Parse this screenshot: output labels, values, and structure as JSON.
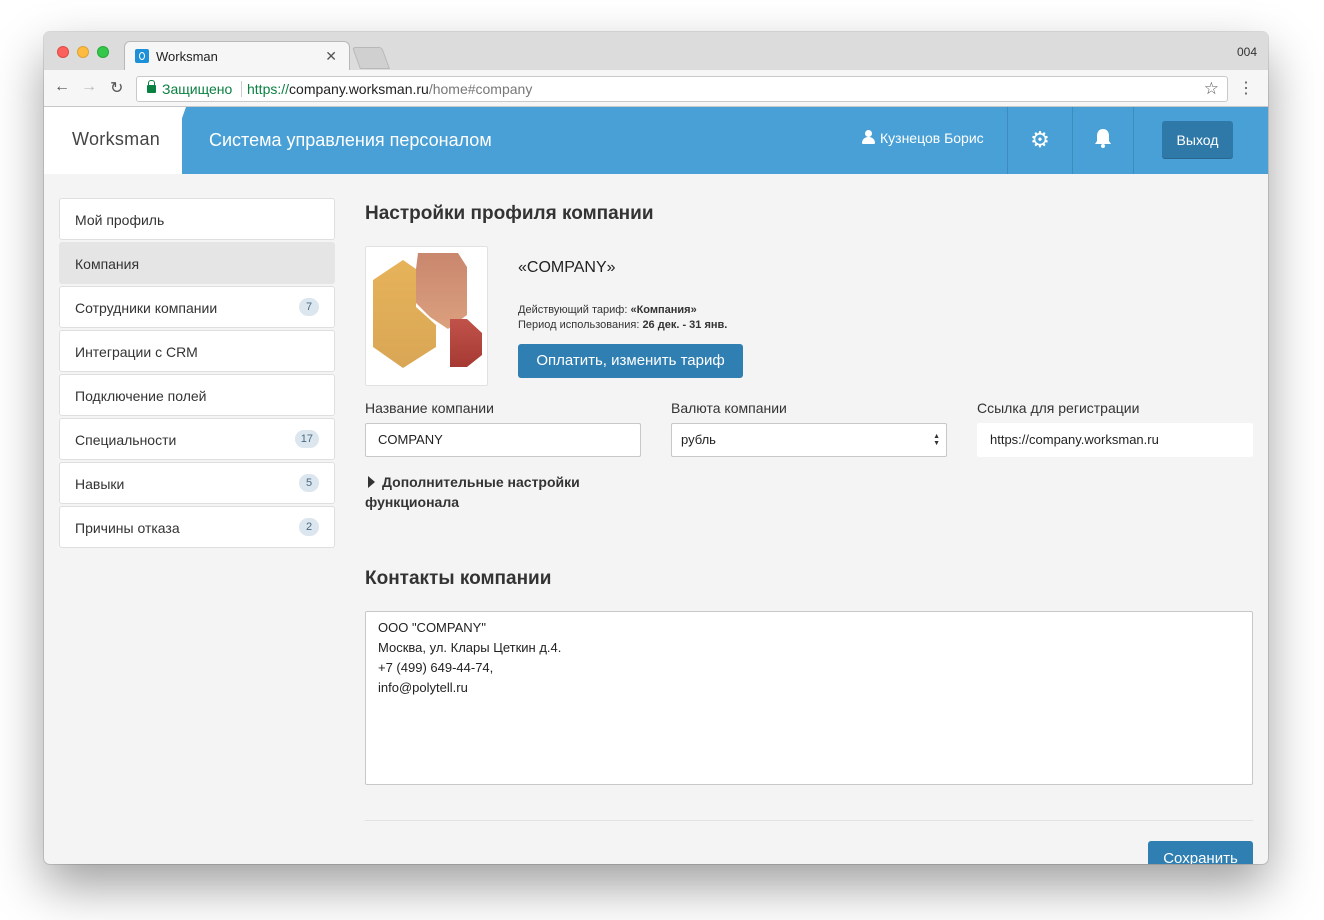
{
  "browser": {
    "tab_title": "Worksman",
    "window_label": "004",
    "secure_label": "Защищено",
    "url_scheme": "https://",
    "url_host": "company.worksman.ru",
    "url_path": "/home#company"
  },
  "header": {
    "logo": "Worksman",
    "title": "Система управления персоналом",
    "user_name": "Кузнецов Борис",
    "logout_label": "Выход",
    "accent_color": "#48a0d6"
  },
  "sidebar": {
    "items": [
      {
        "label": "Мой профиль",
        "badge": ""
      },
      {
        "label": "Компания",
        "badge": ""
      },
      {
        "label": "Сотрудники компании",
        "badge": "7"
      },
      {
        "label": "Интеграции с CRM",
        "badge": ""
      },
      {
        "label": "Подключение полей",
        "badge": ""
      },
      {
        "label": "Специальности",
        "badge": "17"
      },
      {
        "label": "Навыки",
        "badge": "5"
      },
      {
        "label": "Причины отказа",
        "badge": "2"
      }
    ]
  },
  "main": {
    "page_title": "Настройки профиля компании",
    "company_display_name": "«COMPANY»",
    "tariff_prefix": "Действующий тариф: ",
    "tariff_value": "«Компания»",
    "period_prefix": "Период использования: ",
    "period_value": "26 дек. - 31 янв.",
    "pay_button": "Оплатить, изменить тариф",
    "fields": {
      "name_label": "Название компании",
      "name_value": "COMPANY",
      "currency_label": "Валюта компании",
      "currency_value": "рубль",
      "reg_link_label": "Ссылка для регистрации",
      "reg_link_value": "https://company.worksman.ru"
    },
    "extra_settings_label": "Дополнительные настройки функционала",
    "contacts_title": "Контакты компании",
    "contacts_lines": [
      "ООО \"COMPANY\"",
      "Москва, ул. Клары Цеткин д.4.",
      "+7 (499) 649-44-74,",
      "info@polytell.ru"
    ],
    "save_button": "Сохранить"
  }
}
